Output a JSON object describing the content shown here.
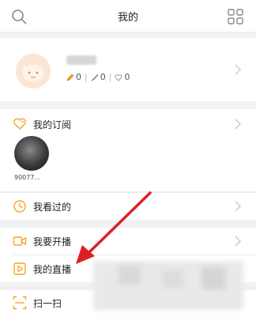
{
  "header": {
    "title": "我的",
    "left_icon": "search-icon",
    "right_icon": "grid-icon"
  },
  "profile": {
    "stats": [
      {
        "icon": "pencil-icon",
        "value": "0"
      },
      {
        "icon": "brush-icon",
        "value": "0"
      },
      {
        "icon": "heart-icon",
        "value": "0"
      }
    ]
  },
  "subscription": {
    "label": "我的订阅",
    "icon": "heart-tag-icon",
    "channel_name": "90077..."
  },
  "menu": {
    "history": {
      "label": "我看过的",
      "icon": "clock-icon"
    },
    "start_live": {
      "label": "我要开播",
      "icon": "video-camera-icon"
    },
    "my_live": {
      "label": "我的直播",
      "icon": "play-icon"
    },
    "scan": {
      "label": "扫一扫",
      "icon": "scan-icon"
    }
  },
  "colors": {
    "accent": "#f5a623",
    "arrow": "#e02020",
    "divider_gap": "#f2f2f2"
  }
}
